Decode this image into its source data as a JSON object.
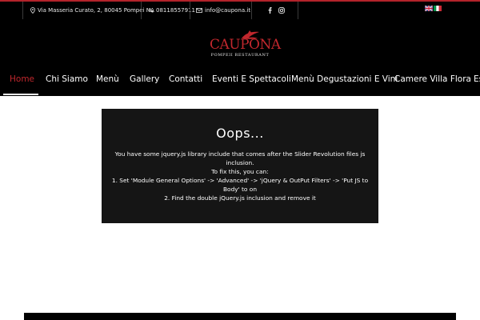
{
  "topbar": {
    "address": "Via Masseria Curato, 2, 80045 Pompei NA",
    "phone": "08118557911",
    "email": "info@caupona.it"
  },
  "logo": {
    "name": "CAUPONA",
    "subtitle": "POMPEII RESTAURANT"
  },
  "nav": {
    "items": [
      "Home",
      "Chi Siamo",
      "Menù",
      "Gallery",
      "Contatti",
      "Eventi E Spettacoli",
      "Menù Degustazioni E Vini",
      "Camere Villa Flora",
      "Es"
    ],
    "active": "Home"
  },
  "error": {
    "title": "Oops...",
    "line1": "You have some jquery.js library include that comes after the Slider Revolution files js inclusion.",
    "line2": "To fix this, you can:",
    "line3": "1. Set 'Module General Options' -> 'Advanced' -> 'jQuery & OutPut Filters' -> 'Put JS to Body' to on",
    "line4": "2. Find the double jQuery.js inclusion and remove it"
  },
  "colors": {
    "accent": "#c0272d",
    "background": "#000000",
    "panel": "#151515"
  },
  "icons": [
    "map-pin-icon",
    "phone-icon",
    "mail-icon",
    "facebook-icon",
    "instagram-icon",
    "uk-flag-icon",
    "italy-flag-icon"
  ]
}
